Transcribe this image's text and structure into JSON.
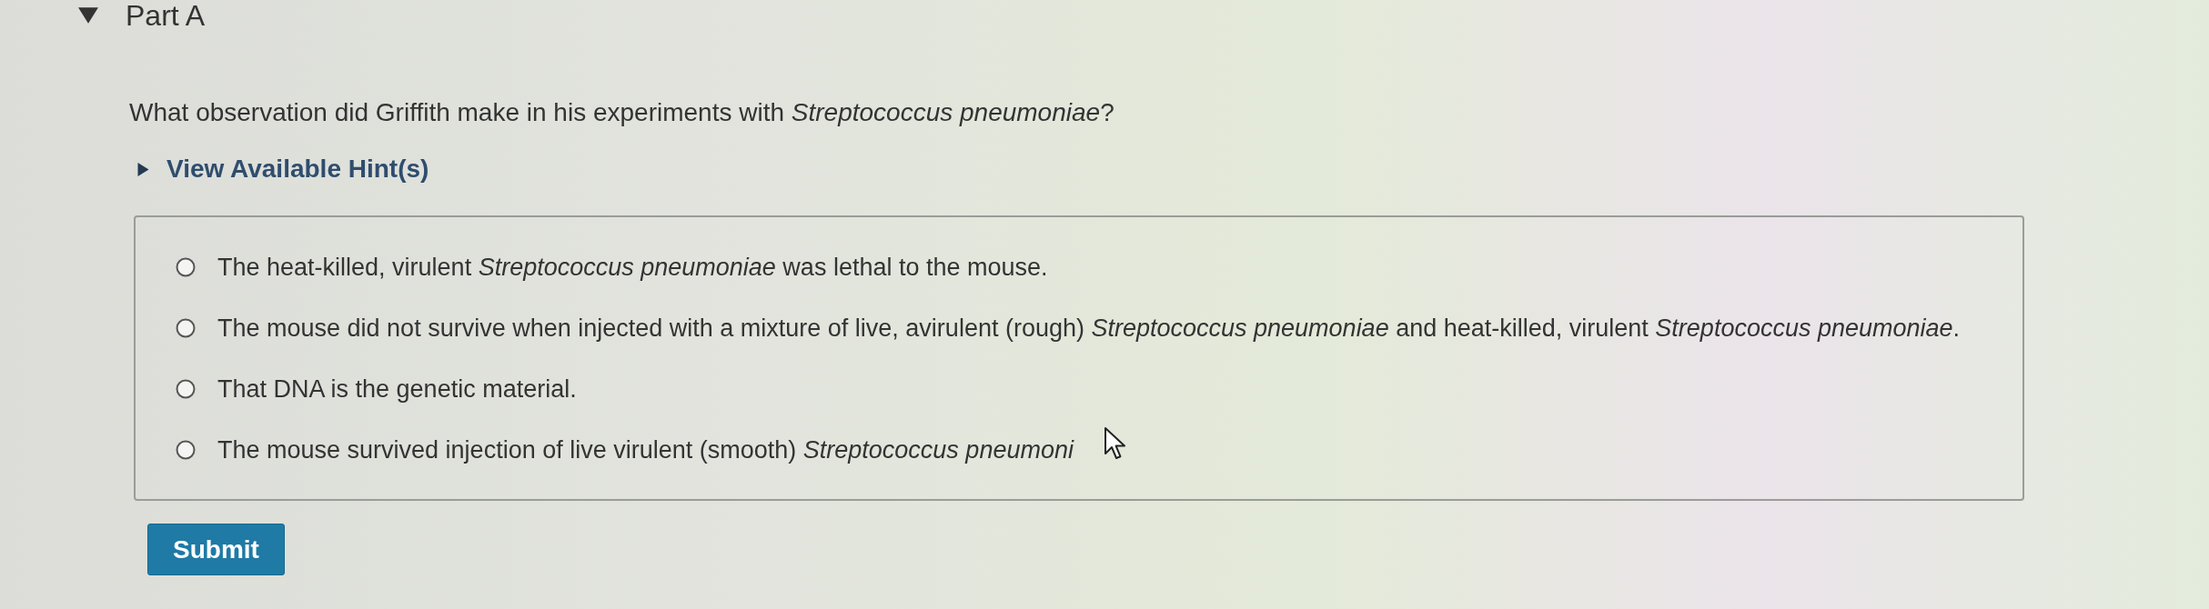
{
  "part": {
    "title": "Part A",
    "expanded": true
  },
  "question": {
    "text": "What observation did Griffith make in his experiments with *Streptococcus pneumoniae*?"
  },
  "hints": {
    "label": "View Available Hint(s)",
    "expanded": false
  },
  "options": [
    {
      "text": "The heat-killed, virulent *Streptococcus pneumoniae* was lethal to the mouse.",
      "selected": false
    },
    {
      "text": "The mouse did not survive when injected with a mixture of live, avirulent (rough) *Streptococcus pneumoniae* and heat-killed, virulent *Streptococcus pneumoniae*.",
      "selected": false
    },
    {
      "text": "That DNA is the genetic material.",
      "selected": false
    },
    {
      "text": "The mouse survived injection of live virulent (smooth) *Streptococcus pneumoni*",
      "selected": false
    }
  ],
  "submit": {
    "label": "Submit"
  }
}
